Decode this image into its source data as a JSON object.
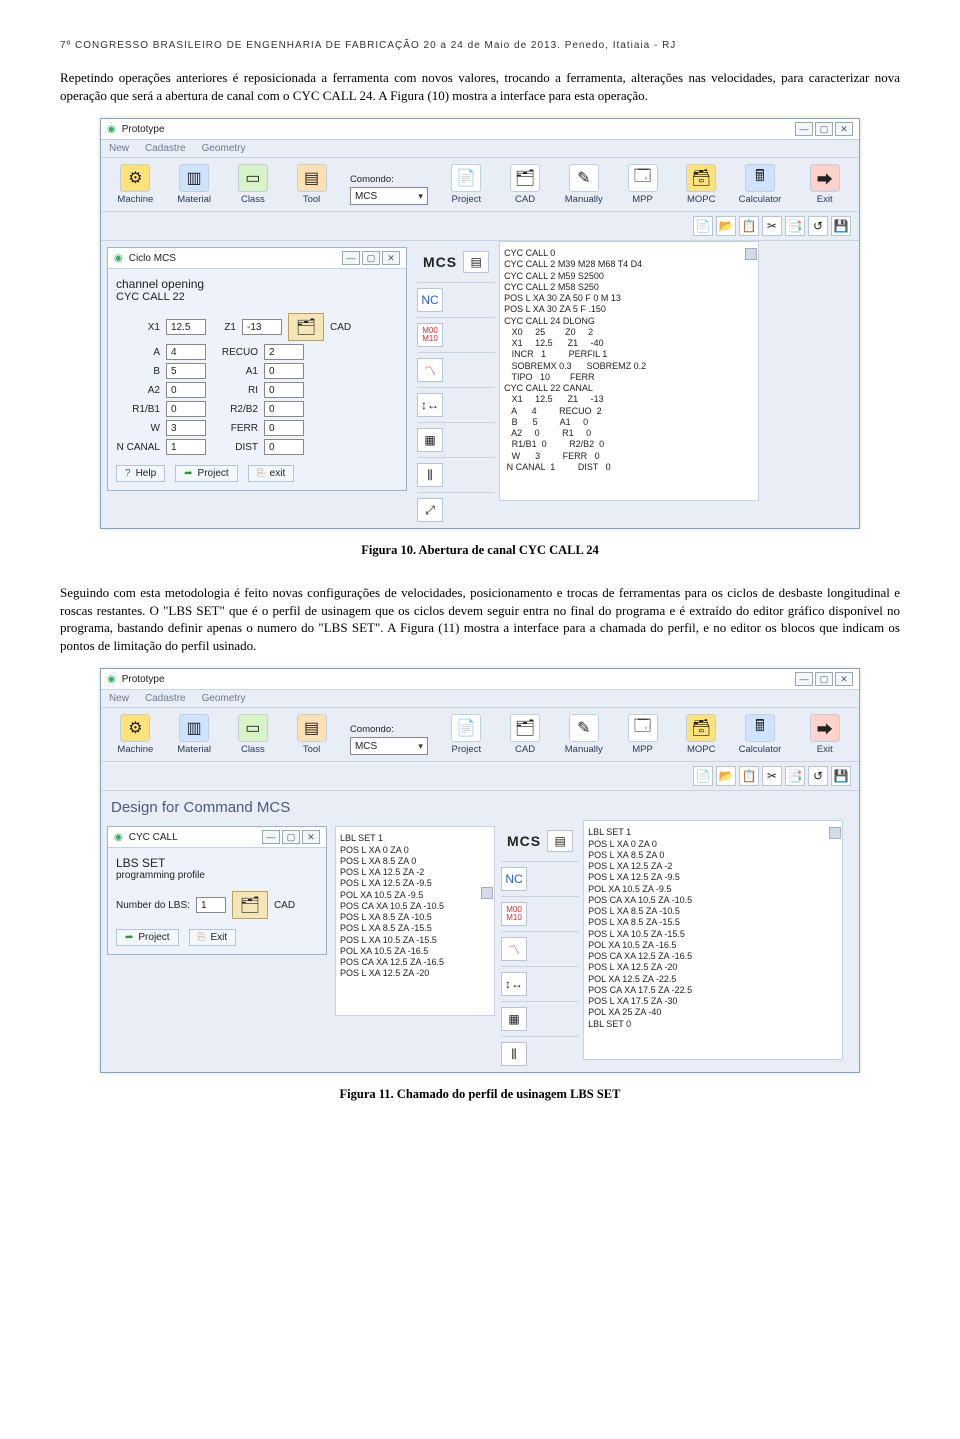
{
  "header": "7º CONGRESSO BRASILEIRO DE ENGENHARIA DE FABRICAÇÃO 20 a 24 de Maio de 2013. Penedo, Itatiaia - RJ",
  "para1": "Repetindo operações anteriores é reposicionada a ferramenta com novos valores, trocando a ferramenta, alterações nas velocidades, para caracterizar nova operação que será a abertura de canal com o CYC CALL 24. A Figura (10) mostra a interface para esta operação.",
  "caption1": "Figura 10. Abertura de canal CYC CALL 24",
  "para2": "Seguindo com esta metodologia é feito novas configurações de velocidades, posicionamento e trocas de ferramentas para os ciclos de desbaste longitudinal e roscas restantes. O \"LBS SET\" que é o perfil de usinagem que os ciclos devem seguir entra no final do programa e é extraído do editor gráfico disponível no programa, bastando definir apenas o numero do \"LBS SET\". A Figura (11) mostra a interface para a chamada do perfil, e no editor os blocos que indicam os pontos de limitação do perfil usinado.",
  "caption2": "Figura 11. Chamado do perfil de usinagem LBS SET",
  "app": {
    "title": "Prototype",
    "menu": {
      "new": "New",
      "cadastre": "Cadastre",
      "geometry": "Geometry"
    },
    "toolbar": {
      "machine": "Machine",
      "material": "Material",
      "class": "Class",
      "tool": "Tool",
      "comando_lbl": "Comondo:",
      "comando_val": "MCS",
      "project": "Project",
      "cad": "CAD",
      "manually": "Manually",
      "mpp": "MPP",
      "mopc": "MOPC",
      "calculator": "Calculator",
      "exit": "Exit"
    },
    "miniIcons": [
      "📄",
      "📂",
      "📋",
      "✂",
      "📑",
      "↺",
      "💾"
    ]
  },
  "fig10": {
    "panel_title": "Ciclo MCS",
    "sub1": "channel opening",
    "sub2": "CYC CALL 22",
    "fields": {
      "X1_lbl": "X1",
      "X1": "12.5",
      "Z1_lbl": "Z1",
      "Z1": "-13",
      "cad": "CAD",
      "A_lbl": "A",
      "A": "4",
      "RECUO_lbl": "RECUO",
      "RECUO": "2",
      "B_lbl": "B",
      "B": "5",
      "A1_lbl": "A1",
      "A1": "0",
      "A2_lbl": "A2",
      "A2": "0",
      "RI_lbl": "RI",
      "RI": "0",
      "R1B1_lbl": "R1/B1",
      "R1B1": "0",
      "R2B2_lbl": "R2/B2",
      "R2B2": "0",
      "W_lbl": "W",
      "W": "3",
      "FERR_lbl": "FERR",
      "FERR": "0",
      "NCANAL_lbl": "N CANAL",
      "NCANAL": "1",
      "DIST_lbl": "DIST",
      "DIST": "0"
    },
    "btns": {
      "help": "Help",
      "project": "Project",
      "exit": "exit"
    },
    "code": "CYC CALL 0\nCYC CALL 2 M39 M28 M68 T4 D4\nCYC CALL 2 M59 S2500\nCYC CALL 2 M58 S250\nPOS L XA 30 ZA 50 F 0 M 13\nPOS L XA 30 ZA 5 F .150\nCYC CALL 24 DLONG\n   X0     25        Z0     2\n   X1     12.5      Z1     -40\n   INCR   1         PERFIL 1\n   SOBREMX 0.3      SOBREMZ 0.2\n   TIPO   10        FERR\nCYC CALL 22 CANAL\n   X1     12.5      Z1     -13\n   A      4         RECUO  2\n   B      5         A1     0\n   A2     0         R1     0\n   R1/B1  0         R2/B2  0\n   W      3         FERR   0\n N CANAL  1         DIST   0"
  },
  "fig11": {
    "design_label": "Design for Command  MCS",
    "panel_title": "CYC CALL",
    "sub1": "LBS SET",
    "sub2": "programming profile",
    "num_lbl": "Number do LBS:",
    "num_val": "1",
    "cad": "CAD",
    "btns": {
      "project": "Project",
      "exit": "Exit"
    },
    "panel_preview": "LBL SET 1\nPOS L XA 0 ZA 0\nPOS L XA 8.5 ZA 0\nPOS L XA 12.5 ZA -2\nPOS L XA 12.5 ZA -9.5\nPOL XA 10.5 ZA -9.5\nPOS CA XA 10.5 ZA -10.5\nPOS L XA 8.5 ZA -10.5\nPOS L XA 8.5 ZA -15.5\nPOS L XA 10.5 ZA -15.5\nPOL XA 10.5 ZA -16.5\nPOS CA XA 12.5 ZA -16.5\nPOS L XA 12.5 ZA -20",
    "code": "LBL SET 1\nPOS L XA 0 ZA 0\nPOS L XA 8.5 ZA 0\nPOS L XA 12.5 ZA -2\nPOS L XA 12.5 ZA -9.5\nPOL XA 10.5 ZA -9.5\nPOS CA XA 10.5 ZA -10.5\nPOS L XA 8.5 ZA -10.5\nPOS L XA 8.5 ZA -15.5\nPOS L XA 10.5 ZA -15.5\nPOL XA 10.5 ZA -16.5\nPOS CA XA 12.5 ZA -16.5\nPOS L XA 12.5 ZA -20\nPOL XA 12.5 ZA -22.5\nPOS CA XA 17.5 ZA -22.5\nPOS L XA 17.5 ZA -30\nPOL XA 25 ZA -40\nLBL SET 0"
  }
}
